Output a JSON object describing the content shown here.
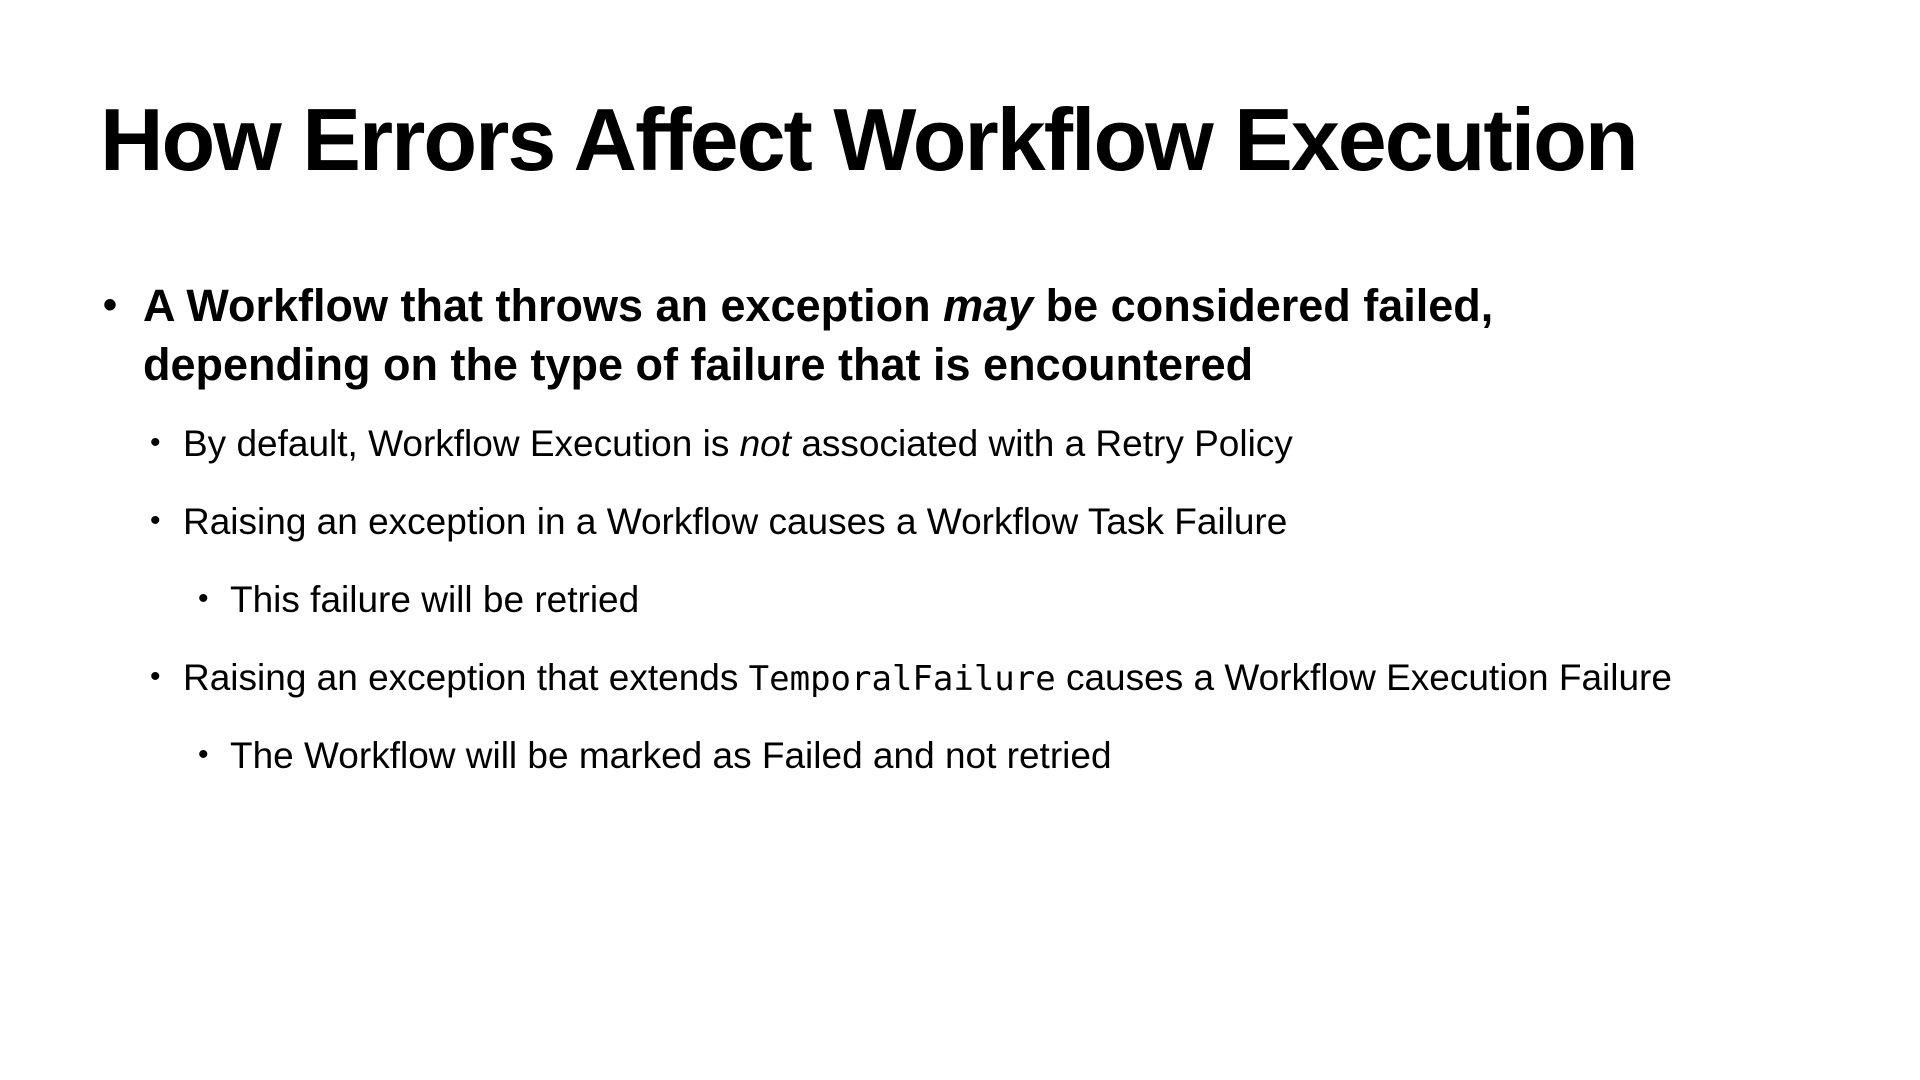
{
  "slide": {
    "title": "How Errors Affect Workflow Execution",
    "bullet_symbol": "•",
    "main_point": {
      "part1": "A Workflow that throws an exception ",
      "emphasis": "may",
      "part2": " be considered failed, depending on the type of failure that is encountered"
    },
    "sub_points": [
      {
        "part1": "By default, Workflow Execution is ",
        "emphasis": "not",
        "part2": " associated with a Retry Policy"
      },
      {
        "text": "Raising an exception in a Workflow causes a Workflow Task Failure",
        "detail": "This failure will be retried"
      },
      {
        "part1": "Raising an exception that extends ",
        "code": "TemporalFailure",
        "part2": " causes a Workflow Execution Failure",
        "detail": "The Workflow will be marked as Failed and not retried"
      }
    ]
  }
}
